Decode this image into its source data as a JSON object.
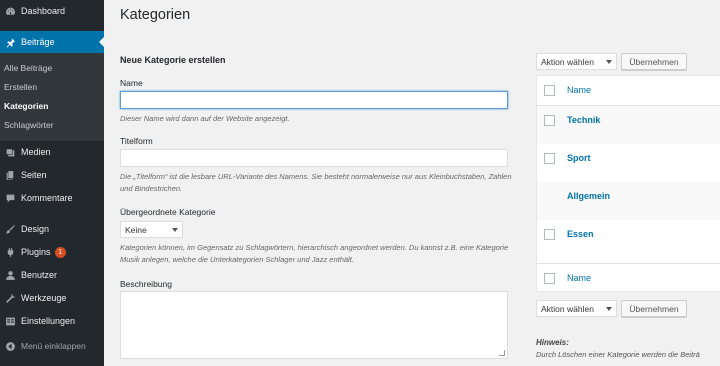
{
  "sidebar": {
    "dashboard": "Dashboard",
    "posts": "Beiträge",
    "submenu": [
      "Alle Beiträge",
      "Erstellen",
      "Kategorien",
      "Schlagwörter"
    ],
    "media": "Medien",
    "pages": "Seiten",
    "comments": "Kommentare",
    "design": "Design",
    "plugins": "Plugins",
    "plugins_badge": "1",
    "users": "Benutzer",
    "tools": "Werkzeuge",
    "settings": "Einstellungen",
    "collapse": "Menü einklappen"
  },
  "page": {
    "title": "Kategorien"
  },
  "form": {
    "heading": "Neue Kategorie erstellen",
    "name_label": "Name",
    "name_value": "",
    "name_desc": "Dieser Name wird dann auf der Website angezeigt.",
    "slug_label": "Titelform",
    "slug_value": "",
    "slug_desc": "Die „Titelform“ ist die lesbare URL-Variante des Namens. Sie besteht normalerweise nur aus Kleinbuchstaben, Zahlen und Bindestrichen.",
    "parent_label": "Übergeordnete Kategorie",
    "parent_selected": "Keine",
    "parent_desc": "Kategorien können, im Gegensatz zu Schlagwörtern, hierarchisch angeordnet werden. Du kannst z.B. eine Kategorie Musik anlegen, welche die Unterkategorien Schlager und Jazz enthält.",
    "description_label": "Beschreibung"
  },
  "list": {
    "bulk_action": "Aktion wählen",
    "apply": "Übernehmen",
    "column_name": "Name",
    "rows": [
      "Technik",
      "Sport",
      "Allgemein",
      "Essen"
    ],
    "hint_title": "Hinweis:",
    "hint_text": "Durch Löschen einer Kategorie werden die Beiträ"
  }
}
